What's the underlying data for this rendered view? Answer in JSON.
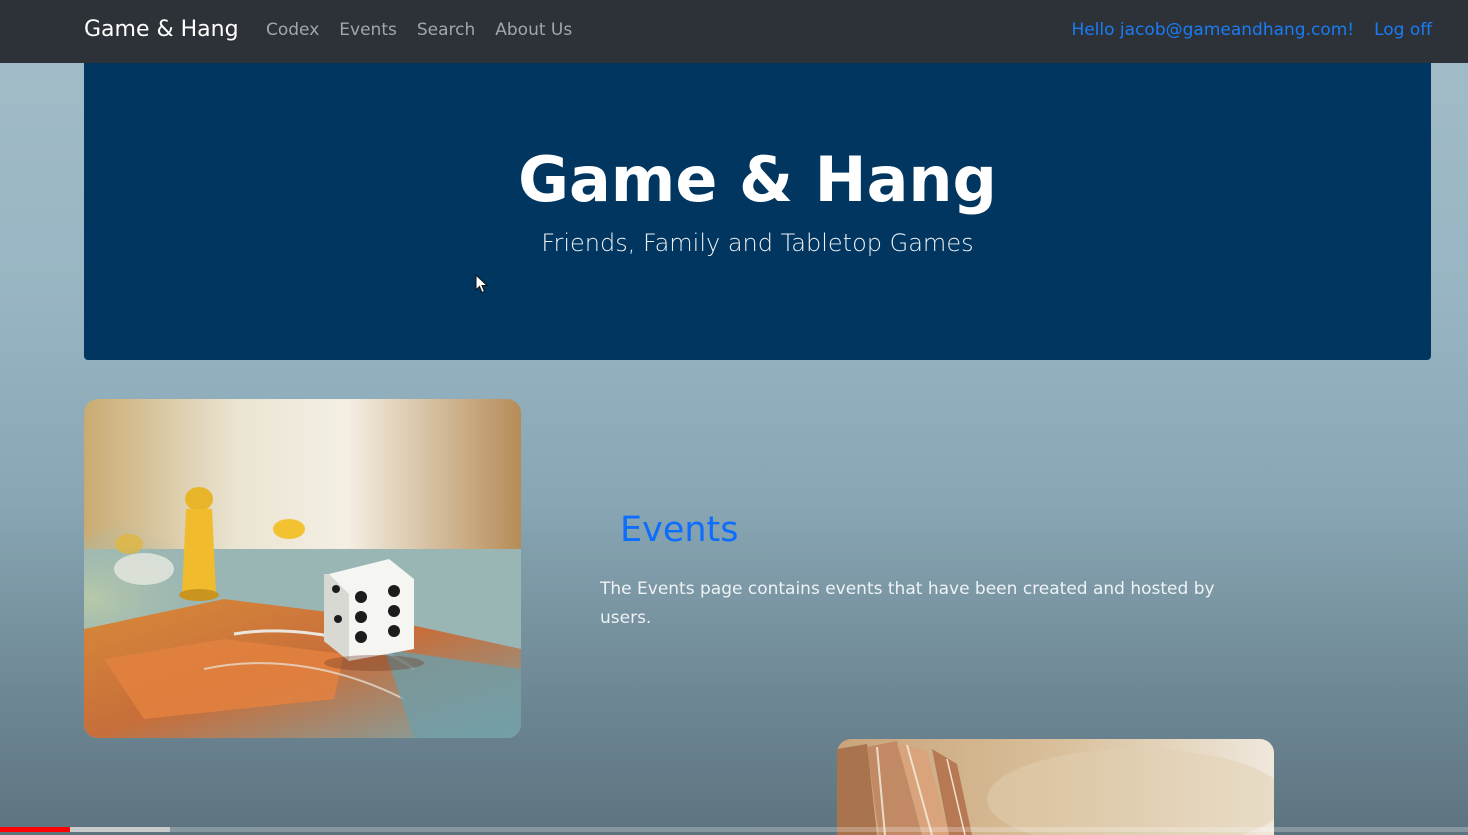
{
  "nav": {
    "brand": "Game & Hang",
    "links": [
      "Codex",
      "Events",
      "Search",
      "About Us"
    ],
    "greeting": "Hello jacob@gameandhang.com!",
    "logoff": "Log off"
  },
  "hero": {
    "title": "Game & Hang",
    "subtitle": "Friends, Family and Tabletop Games"
  },
  "events": {
    "title": "Events",
    "description": "The Events page contains events that have been created and hosted by users."
  },
  "images": {
    "first": "board-game-dice-photo",
    "second": "open-book-photo"
  },
  "video_progress": {
    "played_fraction": 0.048,
    "buffered_fraction": 0.116
  },
  "colors": {
    "navbar": "#2d3238",
    "hero": "#00365f",
    "link_blue": "#1a7cf5",
    "events_title": "#0d6efd",
    "progress_red": "#ff0000"
  }
}
